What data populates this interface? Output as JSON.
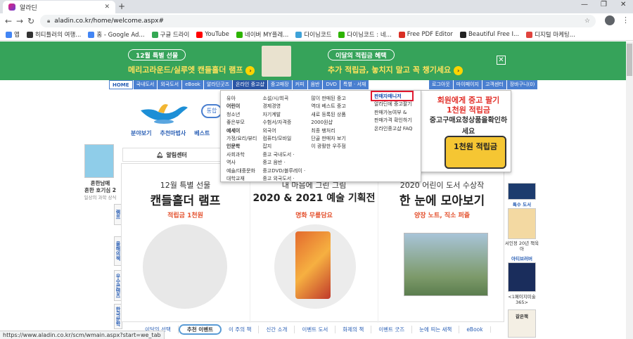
{
  "browser": {
    "tab_title": "알라딘",
    "url": "aladin.co.kr/home/welcome.aspx#",
    "status_url": "https://www.aladin.co.kr/scm/wmain.aspx?start=we_tab"
  },
  "bookmarks": [
    {
      "label": "앱",
      "icon": "apps-icon",
      "color": "#4285f4"
    },
    {
      "label": "히티틀러의 여행...",
      "icon": "dots-icon",
      "color": "#333333"
    },
    {
      "label": "홈 - Google Ad...",
      "icon": "google-icon",
      "color": "#4285f4"
    },
    {
      "label": "구글 드라이",
      "icon": "drive-icon",
      "color": "#34a853"
    },
    {
      "label": "YouTube",
      "icon": "youtube-icon",
      "color": "#ff0000"
    },
    {
      "label": "네이버 MY플레...",
      "icon": "naver-icon",
      "color": "#2db400"
    },
    {
      "label": "다이닝코드",
      "icon": "dining-icon",
      "color": "#3ea2d8"
    },
    {
      "label": "다이닝코드 : 네...",
      "icon": "dining2-icon",
      "color": "#2db400"
    },
    {
      "label": "Free PDF Editor",
      "icon": "pdf-icon",
      "color": "#d93025"
    },
    {
      "label": "Beautiful Free I...",
      "icon": "beautiful-icon",
      "color": "#222222"
    },
    {
      "label": "디지털 마케팅...",
      "icon": "digital-icon",
      "color": "#e0443e"
    }
  ],
  "banner": {
    "left_pill": "12월 특별 선물",
    "left_text": "메리고라운드/실루엣 캔들홀더 램프",
    "right_pill": "이달의 적립금 혜택",
    "right_text": "추가 적립금, 놓치지 말고 꼭 챙기세요"
  },
  "gnb": {
    "items": [
      "HOME",
      "국내도서",
      "외국도서",
      "eBook",
      "알라딘굿즈",
      "온라인 중고샵",
      "중고매장",
      "커피",
      "음반",
      "DVD",
      "특별 · 서재"
    ],
    "right": [
      "로그아웃",
      "마이페이지",
      "고객센터",
      "장바구니(0)"
    ]
  },
  "subnav": [
    "분야보기",
    "추천마법사",
    "베스트"
  ],
  "search_button": "통합",
  "mega_menu": {
    "col1": [
      "유아",
      "어린이",
      "청소년",
      "좋은부모",
      "예세이",
      "가정/요리/뷰티",
      "인문학",
      "사회과학",
      "역사",
      "예술/대중문화",
      "대학교재"
    ],
    "col1_bold": [
      1,
      4,
      6
    ],
    "col2": [
      "소설/시/희곡",
      "경제경영",
      "자기계발",
      "수험서/자격증",
      "외국어",
      "컴퓨터/모바일",
      "잡지",
      "중고 국내도서 ·",
      "중고 음반 ·",
      "중고DVD/블루레이 ·",
      "중고 외국도서 ·"
    ],
    "col3": [
      "많이 판매된 중고",
      "역대 베스트 중고",
      "새로 등록된 상품",
      "2000원샵",
      "최종 팽처리",
      "단골 판매자 보기",
      "이 광활한 우주점"
    ],
    "side": [
      "판매자매니저",
      "알라딘에 중고팔기",
      "판매가능여부 &",
      "판매가격 확인하기",
      "온라인중고샵 FAQ"
    ]
  },
  "promo": {
    "line1": "회원에게 중고 팔기",
    "line2": "1천원 적립금",
    "line3": "중고구매요청상품을확인하세요",
    "coin": "1천원 적립금"
  },
  "alarm_center": "알림센터",
  "left_book": {
    "title1": "흔한남매",
    "title2": "흔한 호기심 2",
    "sub": "일상의 과학 상식"
  },
  "vtabs": [
    "램프",
    "올해의책",
    "우수콘텐츠",
    "한국문학"
  ],
  "panels": [
    {
      "t1": "12월 특별 선물",
      "t2": "캔들홀더 램프",
      "t3": "적립금 1천원"
    },
    {
      "t1": "내 마음에 그린 그림",
      "t2": "2020 & 2021 예술 기획전",
      "t3": "명화 무릎담요"
    },
    {
      "t1": "2020 어린이 도서 수상작",
      "t2": "한 눈에 모아보기",
      "t3": "양장 노트, 직소 퍼즐"
    }
  ],
  "right_books": [
    {
      "label": "특수 도서"
    },
    {
      "label": "서인정 20년 책육아"
    },
    {
      "label": "아티브러버"
    },
    {
      "label": "<1페이지미술 365>"
    },
    {
      "label": "갈은책"
    }
  ],
  "bottom_tabs": [
    "이달의 선택",
    "추천 이벤트",
    "이 주의 책",
    "신간 소개",
    "이벤트 도서",
    "화제의 책",
    "이벤트 굿즈",
    "눈에 띄는 새책",
    "eBook"
  ],
  "colors": {
    "banner_green": "#36a35a",
    "gnb_blue": "#4a7fd0",
    "highlight_red": "#e0192f",
    "accent_orange": "#e4522f",
    "coin_yellow": "#f5c633"
  }
}
